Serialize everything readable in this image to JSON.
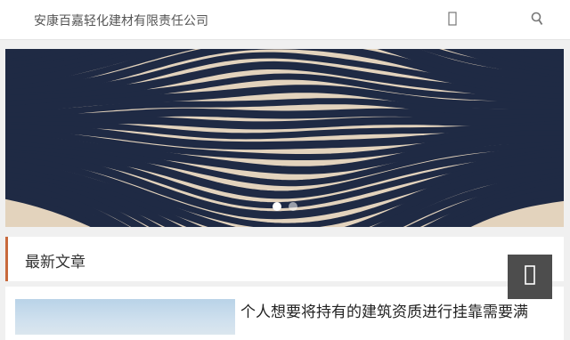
{
  "header": {
    "site_title": "安康百嘉轻化建材有限责任公司",
    "menu_icon": "menu-icon",
    "search_icon": "search-icon"
  },
  "banner": {
    "slides": 2,
    "active_slide": 1
  },
  "section": {
    "title": "最新文章"
  },
  "articles": [
    {
      "title": "个人想要将持有的建筑资质进行挂靠需要满"
    }
  ],
  "back_to_top": {
    "icon": "arrow-up-icon"
  },
  "colors": {
    "accent": "#c8693c",
    "banner_stripe": "#1f2a44",
    "banner_bg": "#e3d3bd",
    "back_to_top_bg": "#4d4d4d"
  }
}
